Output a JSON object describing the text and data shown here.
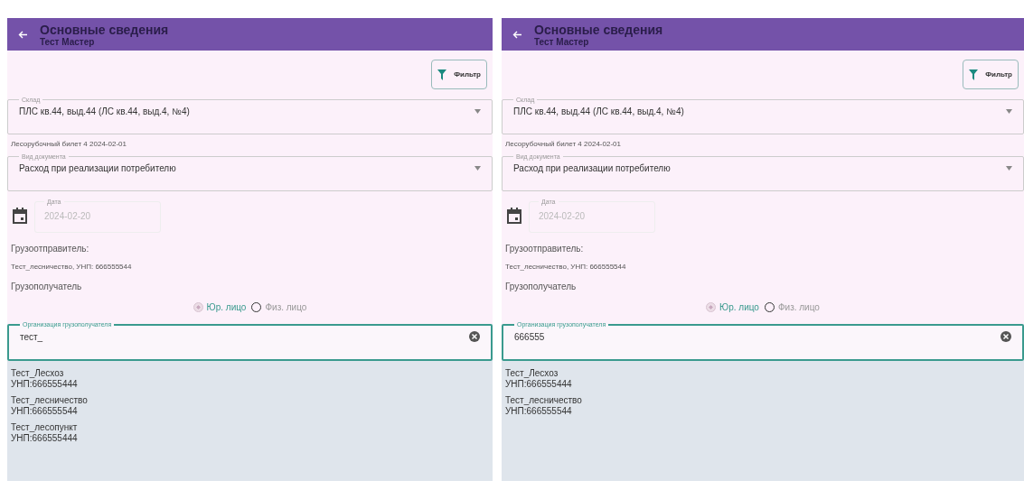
{
  "screens": [
    {
      "title": "Основные сведения",
      "subtitle": "Тест Мастер",
      "filter_button": "Фильтр",
      "warehouse": {
        "label": "Склад",
        "value": "ПЛС кв.44, выд.44 (ЛС кв.44, выд.4, №4)"
      },
      "ticket": "Лесорубочный билет 4 2024-02-01",
      "doc_type": {
        "label": "Вид документа",
        "value": "Расход при реализации потребителю"
      },
      "date": {
        "label": "Дата",
        "value": "2024-02-20",
        "disabled": true
      },
      "shipper_label": "Грузоотправитель:",
      "shipper_value": "Тест_лесничество,  УНП: 666555544",
      "consignee_label": "Грузополучатель",
      "radios": [
        {
          "label": "Юр. лицо",
          "selected": true
        },
        {
          "label": "Физ. лицо",
          "selected": false
        }
      ],
      "org_field": {
        "label": "Организация грузополучателя",
        "value": "тест_"
      },
      "suggestions": [
        {
          "name": "Тест_Лесхоз",
          "unp": "УНП:666555444"
        },
        {
          "name": "Тест_лесничество",
          "unp": "УНП:666555544"
        },
        {
          "name": "Тест_лесопункт",
          "unp": "УНП:666555444"
        }
      ]
    },
    {
      "title": "Основные сведения",
      "subtitle": "Тест Мастер",
      "filter_button": "Фильтр",
      "warehouse": {
        "label": "Склад",
        "value": "ПЛС кв.44, выд.44 (ЛС кв.44, выд.4, №4)"
      },
      "ticket": "Лесорубочный билет 4 2024-02-01",
      "doc_type": {
        "label": "Вид документа",
        "value": "Расход при реализации потребителю"
      },
      "date": {
        "label": "Дата",
        "value": "2024-02-20",
        "disabled": true
      },
      "shipper_label": "Грузоотправитель:",
      "shipper_value": "Тест_лесничество,  УНП: 666555544",
      "consignee_label": "Грузополучатель",
      "radios": [
        {
          "label": "Юр. лицо",
          "selected": true
        },
        {
          "label": "Физ. лицо",
          "selected": false
        }
      ],
      "org_field": {
        "label": "Организация грузополучателя",
        "value": "666555"
      },
      "suggestions": [
        {
          "name": "Тест_Лесхоз",
          "unp": "УНП:666555444"
        },
        {
          "name": "Тест_лесничество",
          "unp": "УНП:666555544"
        }
      ]
    }
  ]
}
